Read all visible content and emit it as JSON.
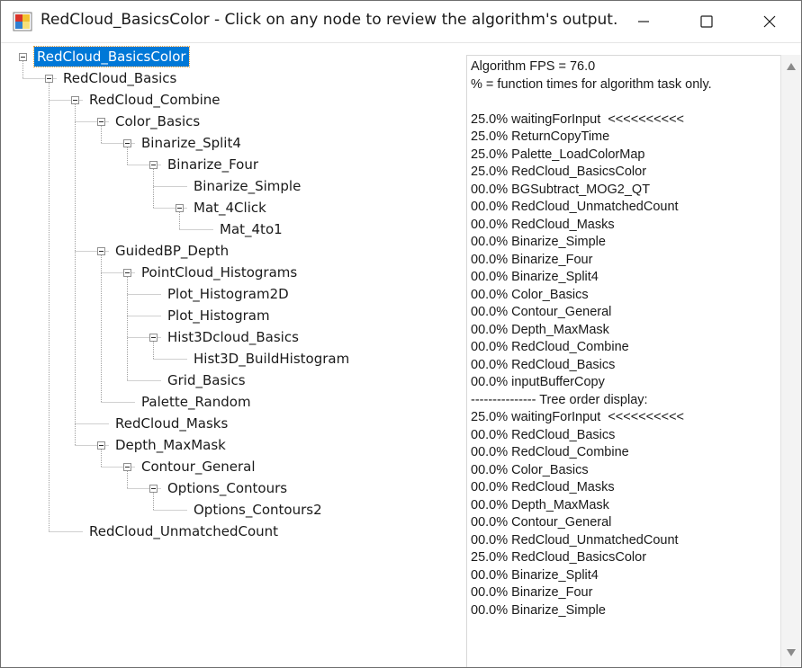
{
  "window": {
    "title": "RedCloud_BasicsColor - Click on any node to review the algorithm's output."
  },
  "tree": {
    "nodes": [
      {
        "label": "RedCloud_BasicsColor",
        "depth": 0,
        "expanded": true,
        "selected": true
      },
      {
        "label": "RedCloud_Basics",
        "depth": 1,
        "expanded": true
      },
      {
        "label": "RedCloud_Combine",
        "depth": 2,
        "expanded": true
      },
      {
        "label": "Color_Basics",
        "depth": 3,
        "expanded": true
      },
      {
        "label": "Binarize_Split4",
        "depth": 4,
        "expanded": true
      },
      {
        "label": "Binarize_Four",
        "depth": 5,
        "expanded": true
      },
      {
        "label": "Binarize_Simple",
        "depth": 6,
        "expanded": false
      },
      {
        "label": "Mat_4Click",
        "depth": 6,
        "expanded": true
      },
      {
        "label": "Mat_4to1",
        "depth": 7,
        "expanded": false
      },
      {
        "label": "GuidedBP_Depth",
        "depth": 3,
        "expanded": true
      },
      {
        "label": "PointCloud_Histograms",
        "depth": 4,
        "expanded": true
      },
      {
        "label": "Plot_Histogram2D",
        "depth": 5,
        "expanded": false
      },
      {
        "label": "Plot_Histogram",
        "depth": 5,
        "expanded": false
      },
      {
        "label": "Hist3Dcloud_Basics",
        "depth": 5,
        "expanded": true
      },
      {
        "label": "Hist3D_BuildHistogram",
        "depth": 6,
        "expanded": false
      },
      {
        "label": "Grid_Basics",
        "depth": 5,
        "expanded": false
      },
      {
        "label": "Palette_Random",
        "depth": 4,
        "expanded": false
      },
      {
        "label": "RedCloud_Masks",
        "depth": 3,
        "expanded": false
      },
      {
        "label": "Depth_MaxMask",
        "depth": 3,
        "expanded": true
      },
      {
        "label": "Contour_General",
        "depth": 4,
        "expanded": true
      },
      {
        "label": "Options_Contours",
        "depth": 5,
        "expanded": true
      },
      {
        "label": "Options_Contours2",
        "depth": 6,
        "expanded": false
      },
      {
        "label": "RedCloud_UnmatchedCount",
        "depth": 2,
        "expanded": false
      }
    ]
  },
  "report": {
    "lines": [
      "Algorithm FPS = 76.0",
      "% = function times for algorithm task only.",
      "",
      "25.0% waitingForInput  <<<<<<<<<<",
      "25.0% ReturnCopyTime",
      "25.0% Palette_LoadColorMap",
      "25.0% RedCloud_BasicsColor",
      "00.0% BGSubtract_MOG2_QT",
      "00.0% RedCloud_UnmatchedCount",
      "00.0% RedCloud_Masks",
      "00.0% Binarize_Simple",
      "00.0% Binarize_Four",
      "00.0% Binarize_Split4",
      "00.0% Color_Basics",
      "00.0% Contour_General",
      "00.0% Depth_MaxMask",
      "00.0% RedCloud_Combine",
      "00.0% RedCloud_Basics",
      "00.0% inputBufferCopy",
      "--------------- Tree order display:",
      "25.0% waitingForInput  <<<<<<<<<<",
      "00.0% RedCloud_Basics",
      "00.0% RedCloud_Combine",
      "00.0% Color_Basics",
      "00.0% RedCloud_Masks",
      "00.0% Depth_MaxMask",
      "00.0% Contour_General",
      "00.0% RedCloud_UnmatchedCount",
      "25.0% RedCloud_BasicsColor",
      "00.0% Binarize_Split4",
      "00.0% Binarize_Four",
      "00.0% Binarize_Simple"
    ]
  },
  "colors": {
    "selection": "#0078d7",
    "tree_lines": "#a0a0a0",
    "text": "#1a1a1a"
  },
  "icons": {
    "app": "app-icon",
    "minimize": "minimize-icon",
    "maximize": "maximize-icon",
    "close": "close-icon",
    "scroll_up": "scroll-up-arrow-icon",
    "scroll_down": "scroll-down-arrow-icon"
  }
}
